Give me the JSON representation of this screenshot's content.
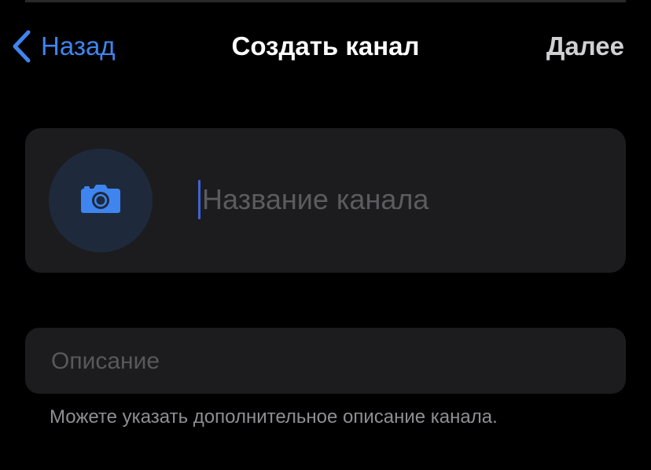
{
  "nav": {
    "back_label": "Назад",
    "title": "Создать канал",
    "next_label": "Далее"
  },
  "channel": {
    "photo_icon": "camera-icon",
    "name_value": "",
    "name_placeholder": "Название канала"
  },
  "description": {
    "value": "",
    "placeholder": "Описание",
    "hint": "Можете указать дополнительное описание канала."
  },
  "colors": {
    "accent": "#3e85f0",
    "background": "#000000",
    "card": "#1c1c1e",
    "placeholder": "#5b5b60",
    "hint": "#8e8e93"
  }
}
